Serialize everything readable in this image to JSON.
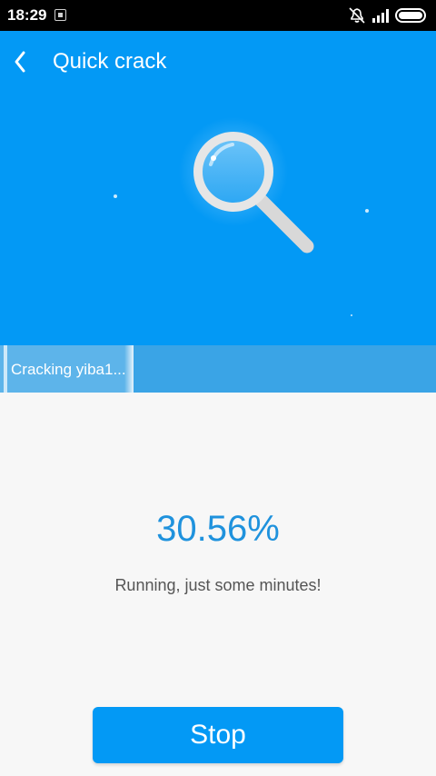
{
  "status_bar": {
    "time": "18:29",
    "icons": [
      "notification-icon",
      "bell-off-icon",
      "signal-icon",
      "battery-icon"
    ]
  },
  "header": {
    "title": "Quick crack",
    "back_icon": "chevron-left-icon",
    "illustration_icon": "magnifier-icon"
  },
  "progress": {
    "label": "Cracking yiba1...",
    "value_fraction": 0.3056
  },
  "status": {
    "percent": "30.56%",
    "message": "Running, just some minutes!"
  },
  "actions": {
    "stop_label": "Stop"
  },
  "colors": {
    "primary": "#0399f5",
    "progress_band": "#3aa4e6",
    "percent_text": "#1f92dd",
    "background": "#f7f7f7",
    "status_bar": "#000000"
  }
}
